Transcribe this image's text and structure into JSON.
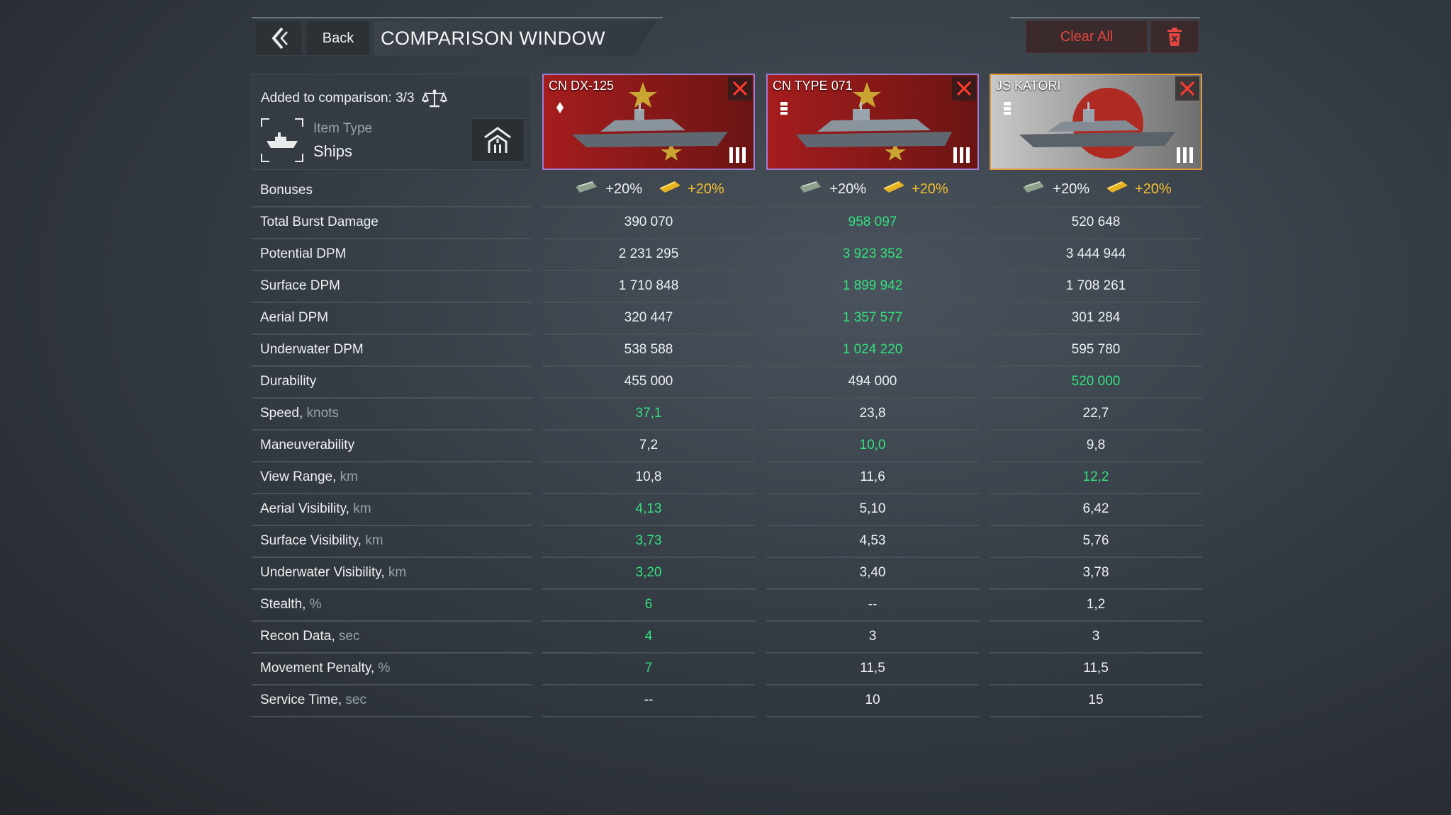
{
  "header": {
    "back_label": "Back",
    "title": "COMPARISON WINDOW",
    "clear_all_label": "Clear All"
  },
  "info": {
    "added_label": "Added to comparison: 3/3",
    "item_type_label": "Item Type",
    "item_type_value": "Ships"
  },
  "ships": [
    {
      "name": "CN DX-125",
      "flag": "china",
      "rarity_color": "#9c7ed6",
      "tier": "III"
    },
    {
      "name": "CN TYPE 071",
      "flag": "china",
      "rarity_color": "#9c7ed6",
      "tier": "III"
    },
    {
      "name": "JS KATORI",
      "flag": "japan",
      "rarity_color": "#e09a3a",
      "tier": "III"
    }
  ],
  "bonuses": {
    "label": "Bonuses",
    "silver": "+20%",
    "gold": "+20%"
  },
  "stats": [
    {
      "label": "Total Burst Damage",
      "unit": "",
      "values": [
        "390 070",
        "958 097",
        "520 648"
      ],
      "best": 1
    },
    {
      "label": "Potential DPM",
      "unit": "",
      "values": [
        "2 231 295",
        "3 923 352",
        "3 444 944"
      ],
      "best": 1
    },
    {
      "label": "Surface DPM",
      "unit": "",
      "values": [
        "1 710 848",
        "1 899 942",
        "1 708 261"
      ],
      "best": 1
    },
    {
      "label": "Aerial DPM",
      "unit": "",
      "values": [
        "320 447",
        "1 357 577",
        "301 284"
      ],
      "best": 1
    },
    {
      "label": "Underwater DPM",
      "unit": "",
      "values": [
        "538 588",
        "1 024 220",
        "595 780"
      ],
      "best": 1
    },
    {
      "label": "Durability",
      "unit": "",
      "values": [
        "455 000",
        "494 000",
        "520 000"
      ],
      "best": 2
    },
    {
      "label": "Speed,",
      "unit": "knots",
      "values": [
        "37,1",
        "23,8",
        "22,7"
      ],
      "best": 0
    },
    {
      "label": "Maneuverability",
      "unit": "",
      "values": [
        "7,2",
        "10,0",
        "9,8"
      ],
      "best": 1
    },
    {
      "label": "View Range,",
      "unit": "km",
      "values": [
        "10,8",
        "11,6",
        "12,2"
      ],
      "best": 2
    },
    {
      "label": "Aerial Visibility,",
      "unit": "km",
      "values": [
        "4,13",
        "5,10",
        "6,42"
      ],
      "best": 0
    },
    {
      "label": "Surface Visibility,",
      "unit": "km",
      "values": [
        "3,73",
        "4,53",
        "5,76"
      ],
      "best": 0
    },
    {
      "label": "Underwater Visibility,",
      "unit": "km",
      "values": [
        "3,20",
        "3,40",
        "3,78"
      ],
      "best": 0
    },
    {
      "label": "Stealth,",
      "unit": "%",
      "values": [
        "6",
        "--",
        "1,2"
      ],
      "best": 0
    },
    {
      "label": "Recon Data,",
      "unit": "sec",
      "values": [
        "4",
        "3",
        "3"
      ],
      "best": 0
    },
    {
      "label": "Movement Penalty,",
      "unit": "%",
      "values": [
        "7",
        "11,5",
        "11,5"
      ],
      "best": 0
    },
    {
      "label": "Service Time,",
      "unit": "sec",
      "values": [
        "--",
        "10",
        "15"
      ],
      "best": -1
    }
  ],
  "colors": {
    "best": "#33e07d",
    "danger": "#e2463f",
    "gold": "#f2c230",
    "epic": "#9c7ed6",
    "legendary": "#e09a3a"
  }
}
